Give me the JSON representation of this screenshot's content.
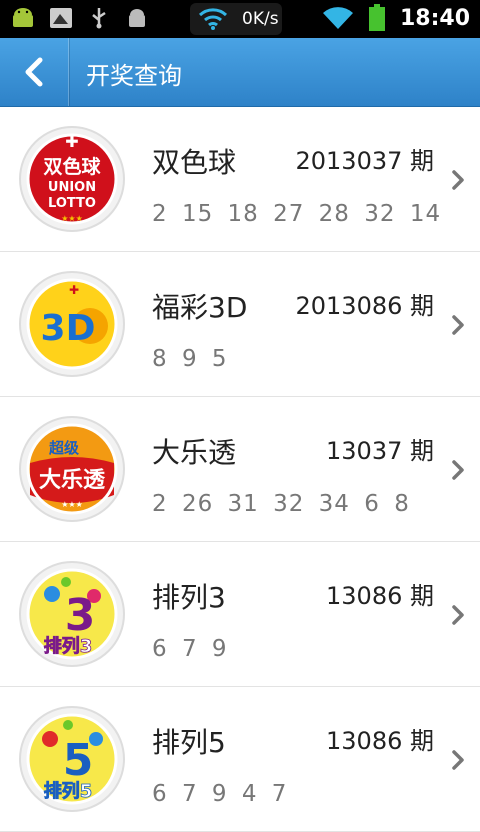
{
  "status": {
    "speed": "0K/s",
    "time": "18:40",
    "battery_color": "#47c22f",
    "wifi_color": "#33b5e5"
  },
  "header": {
    "title": "开奖查询",
    "bg_color": "#3a90d4"
  },
  "lotteries": [
    {
      "name": "双色球",
      "period": "2013037 期",
      "numbers": "2 15 18 27 28 32 14",
      "logo_text": [
        "双色球",
        "UNION",
        "LOTTO"
      ]
    },
    {
      "name": "福彩3D",
      "period": "2013086 期",
      "numbers": "8 9 5",
      "logo_text": [
        "3D"
      ]
    },
    {
      "name": "大乐透",
      "period": "13037 期",
      "numbers": "2 26 31 32 34 6 8",
      "logo_text": [
        "超级",
        "大乐透"
      ]
    },
    {
      "name": "排列3",
      "period": "13086 期",
      "numbers": "6 7 9",
      "logo_text": [
        "3",
        "排列3"
      ]
    },
    {
      "name": "排列5",
      "period": "13086 期",
      "numbers": "6 7 9 4 7",
      "logo_text": [
        "5",
        "排列5"
      ]
    }
  ]
}
